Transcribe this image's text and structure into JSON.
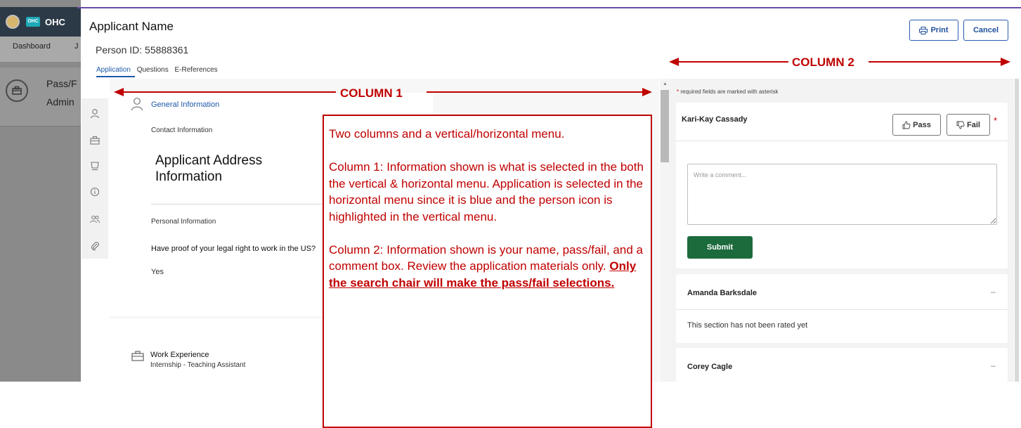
{
  "bg_app": {
    "logo_badge": "OHC",
    "logo_text": "OHC",
    "nav": [
      "Dashboard",
      "J"
    ],
    "card_line1": "Pass/F",
    "card_line2": "Admin"
  },
  "header": {
    "applicant_name": "Applicant Name",
    "person_id": "Person ID: 55888361",
    "tabs": [
      {
        "label": "Application",
        "active": true
      },
      {
        "label": "Questions",
        "active": false
      },
      {
        "label": "E-References",
        "active": false
      }
    ],
    "print_label": "Print",
    "cancel_label": "Cancel"
  },
  "column1": {
    "vertical_menu_icons": [
      "person-icon",
      "briefcase-icon",
      "certificate-icon",
      "info-icon",
      "people-icon",
      "attachment-icon"
    ],
    "section_title": "General Information",
    "contact_info": "Contact Information",
    "address": "Applicant Address Information",
    "personal_info": "Personal Information",
    "legal_question": "Have proof of your legal right to work in the US?",
    "legal_answer": "Yes",
    "work_title": "Work Experience",
    "work_subtitle": "Internship - Teaching Assistant"
  },
  "column2": {
    "required_note": "required fields are marked with asterisk",
    "reviewers": [
      {
        "name": "Kari-Kay Cassady"
      },
      {
        "name": "Amanda Barksdale",
        "status": "--",
        "note": "This section has not been rated yet"
      },
      {
        "name": "Corey Cagle",
        "status": "--"
      }
    ],
    "pass_label": "Pass",
    "fail_label": "Fail",
    "comment_placeholder": "Write a comment...",
    "submit_label": "Submit"
  },
  "annotations": {
    "column1_label": "COLUMN 1",
    "column2_label": "COLUMN 2",
    "callout": {
      "p1": "Two columns and a vertical/horizontal menu.",
      "p2": "Column 1: Information shown is what is selected in the both the vertical & horizontal menu.  Application is selected in the horizontal menu since it is blue and the person icon is highlighted in the vertical menu.",
      "p3": "Column 2: Information shown is your name, pass/fail, and a comment box.  Review the application materials only. ",
      "p3_emphasis": "Only the search chair will make the pass/fail selections."
    }
  },
  "colors": {
    "accent_blue": "#1e5aa8",
    "annotation_red": "#c00000",
    "submit_green": "#1c6b3c",
    "top_rule_purple": "#6a4ca8"
  }
}
